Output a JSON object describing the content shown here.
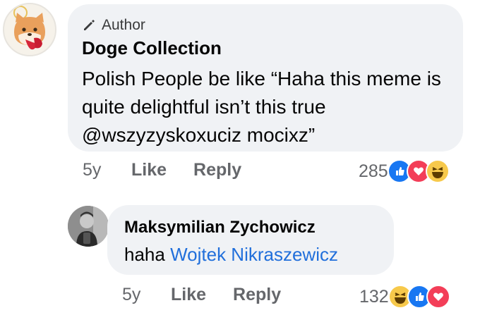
{
  "comment": {
    "author_badge": "Author",
    "author_name": "Doge Collection",
    "text": "Polish People be like “Haha this meme is quite delightful isn’t this true @wszyzyskoxuciz mocixz”",
    "time": "5y",
    "like_label": "Like",
    "reply_label": "Reply",
    "reaction_count": "285",
    "reactions": [
      "like-icon",
      "love-icon",
      "haha-icon"
    ]
  },
  "reply": {
    "author_name": "Maksymilian Zychowicz",
    "text_prefix": "haha ",
    "mention": "Wojtek Nikraszewicz",
    "time": "5y",
    "like_label": "Like",
    "reply_label": "Reply",
    "reaction_count": "132",
    "reactions": [
      "haha-icon",
      "like-icon",
      "love-icon"
    ]
  },
  "colors": {
    "bubble": "#f0f2f5",
    "mention": "#216fdb",
    "meta_text": "#65676b",
    "like": "#1877f2",
    "love": "#f33e58",
    "haha": "#f7c94b"
  }
}
